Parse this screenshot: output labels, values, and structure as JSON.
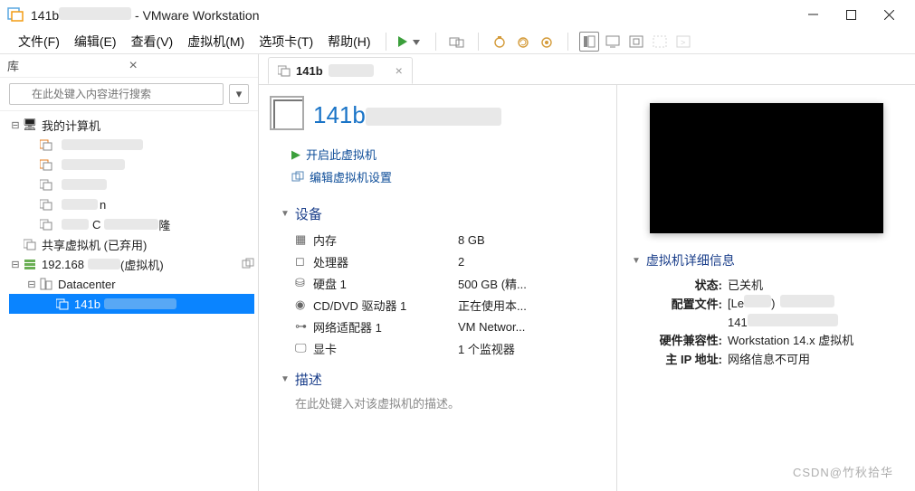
{
  "window": {
    "title_prefix": "141b",
    "title_suffix": " - VMware Workstation"
  },
  "menu": {
    "file": "文件(F)",
    "edit": "编辑(E)",
    "view": "查看(V)",
    "vm": "虚拟机(M)",
    "tabs": "选项卡(T)",
    "help": "帮助(H)"
  },
  "library": {
    "title": "库",
    "search_placeholder": "在此处键入内容进行搜索",
    "my_computer": "我的计算机",
    "shared_vms": "共享虚拟机 (已弃用)",
    "server_prefix": "192.168",
    "server_suffix": "(虚拟机)",
    "datacenter": "Datacenter",
    "selected_vm": "141b"
  },
  "tab": {
    "label": "141b"
  },
  "vm": {
    "name": "141b",
    "power_on": "开启此虚拟机",
    "edit_settings": "编辑虚拟机设置",
    "devices_header": "设备",
    "description_header": "描述",
    "description_placeholder": "在此处键入对该虚拟机的描述。",
    "devices": {
      "memory": {
        "label": "内存",
        "value": "8 GB"
      },
      "cpu": {
        "label": "处理器",
        "value": "2"
      },
      "hdd": {
        "label": "硬盘 1",
        "value": "500 GB (精..."
      },
      "cd": {
        "label": "CD/DVD 驱动器 1",
        "value": "正在使用本..."
      },
      "nic": {
        "label": "网络适配器 1",
        "value": "VM Networ..."
      },
      "display": {
        "label": "显卡",
        "value": "1 个监视器"
      }
    }
  },
  "details": {
    "header": "虚拟机详细信息",
    "state_k": "状态:",
    "state_v": "已关机",
    "config_k": "配置文件:",
    "config_v1": "[Le",
    "config_v2": "141",
    "compat_k": "硬件兼容性:",
    "compat_v": "Workstation 14.x 虚拟机",
    "ip_k": "主 IP 地址:",
    "ip_v": "网络信息不可用"
  },
  "watermark": "CSDN@竹秋拾华"
}
